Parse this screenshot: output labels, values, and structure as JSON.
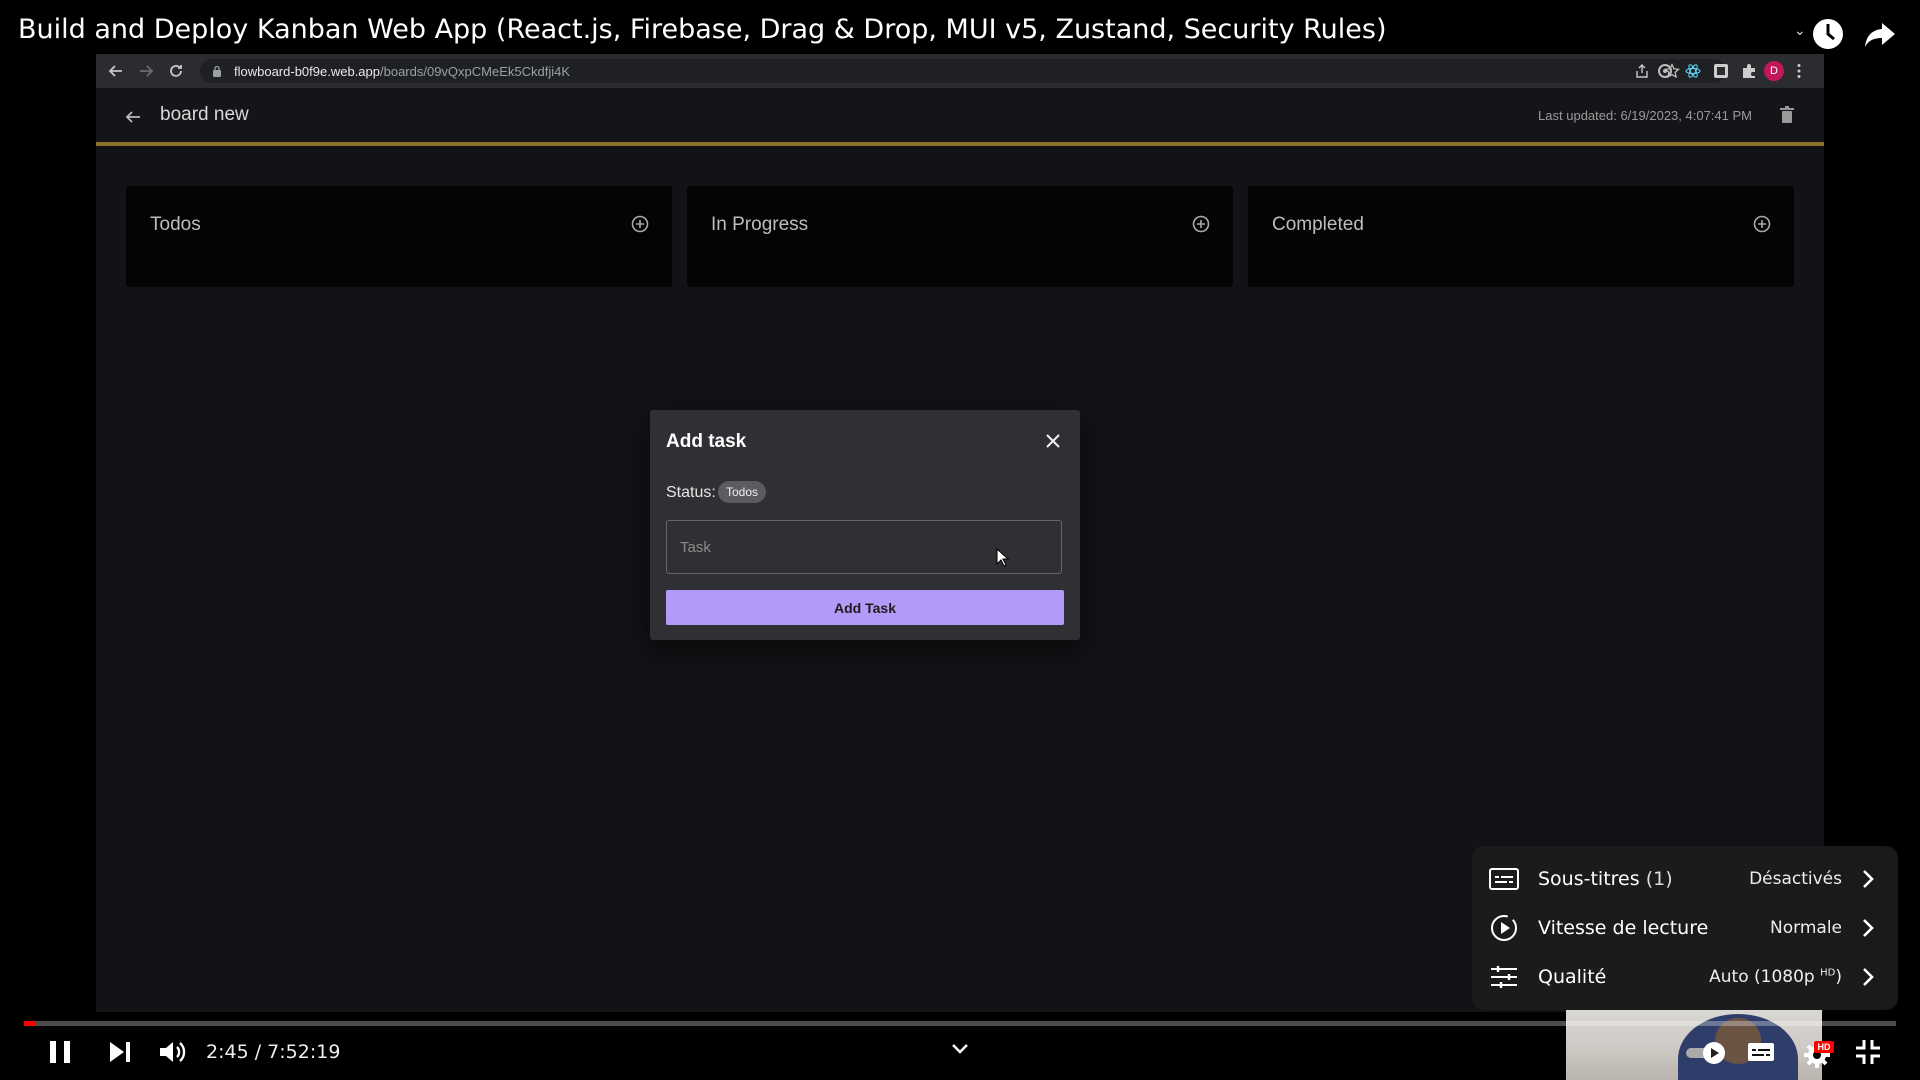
{
  "player": {
    "video_title": "Build and Deploy Kanban Web App (React.js, Firebase, Drag & Drop, MUI v5, Zustand, Security Rules)",
    "current_time": "2:45",
    "separator": " / ",
    "duration": "7:52:19",
    "progress_fraction": 0.006,
    "accent_color": "#ff0000",
    "icons": [
      "clock-icon",
      "share-icon",
      "pause-icon",
      "next-icon",
      "volume-icon",
      "chevron-down-icon",
      "autoplay-toggle-icon",
      "subtitles-icon",
      "settings-icon",
      "exit-fullscreen-icon"
    ],
    "settings_badge": "HD"
  },
  "settings_menu": {
    "items": [
      {
        "label": "Sous-titres",
        "label_extra": " (1)",
        "value": "Désactivés",
        "icon": "subtitles-icon"
      },
      {
        "label": "Vitesse de lecture",
        "label_extra": "",
        "value": "Normale",
        "icon": "playback-speed-icon"
      },
      {
        "label": "Qualité",
        "label_extra": "",
        "value": "Auto (1080p",
        "value_sup": "HD",
        "value_end": ")",
        "icon": "quality-sliders-icon"
      }
    ]
  },
  "browser": {
    "url_host": "flowboard-b0f9e.web.app",
    "url_path": "/boards/09vQxpCMeEk5Ckdfji4K",
    "avatar_letter": "D",
    "avatar_color": "#c2185b"
  },
  "app": {
    "board_title": "board new",
    "last_updated": "Last updated: 6/19/2023, 4:07:41 PM",
    "header_accent": "#8a7330",
    "columns": [
      {
        "title": "Todos"
      },
      {
        "title": "In Progress"
      },
      {
        "title": "Completed"
      }
    ]
  },
  "dialog": {
    "title": "Add task",
    "status_label": "Status:",
    "status_value": "Todos",
    "task_placeholder": "Task",
    "task_value": "",
    "submit_label": "Add Task",
    "submit_color": "#b49af8"
  }
}
